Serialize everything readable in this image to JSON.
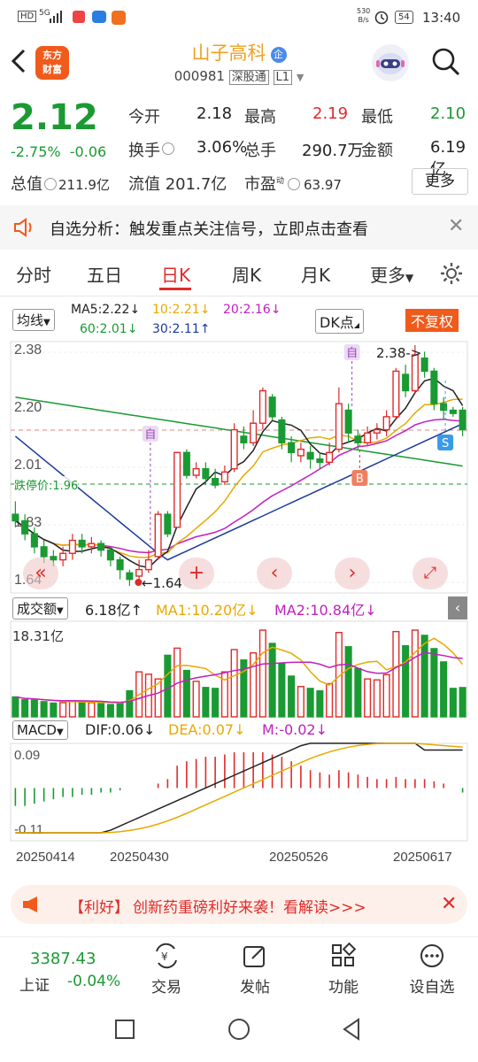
{
  "status": {
    "time": "13:40",
    "network": "5G",
    "hd": "HD",
    "speed": "530",
    "speed_unit": "B/s",
    "battery": "54"
  },
  "header": {
    "title": "山子高科",
    "badge": "企",
    "code": "000981",
    "exchange": "深股通",
    "level": "L1",
    "logo_line1": "东方",
    "logo_line2": "财富"
  },
  "quote": {
    "price": "2.12",
    "change_pct": "-2.75%",
    "change": "-0.06",
    "rows": [
      [
        {
          "label": "今开",
          "value": "2.18",
          "color": "#222"
        },
        {
          "label": "最高",
          "value": "2.19",
          "color": "#e02b2b"
        },
        {
          "label": "最低",
          "value": "2.10",
          "color": "#1a9a32"
        }
      ],
      [
        {
          "label": "换手",
          "value": "3.06%",
          "color": "#222"
        },
        {
          "label": "总手",
          "value": "290.7万",
          "color": "#222"
        },
        {
          "label": "金额",
          "value": "6.19亿",
          "color": "#222"
        }
      ]
    ],
    "total_mv_label": "总值",
    "total_mv": "211.9亿",
    "float_mv_label": "流值",
    "float_mv": "201.7亿",
    "pe_label": "市盈",
    "pe_sup": "动",
    "pe": "63.97",
    "more": "更多"
  },
  "alert": {
    "text": "自选分析：触发重点关注信号，立即点击查看"
  },
  "tabs": [
    "分时",
    "五日",
    "日K",
    "周K",
    "月K",
    "更多"
  ],
  "active_tab": 2,
  "chart_controls": {
    "ma_select": "均线",
    "ma5": "MA5:2.22↓",
    "ma10": "10:2.21↓",
    "ma20": "20:2.16↓",
    "ma60": "60:2.01↓",
    "ma30": "30:2.11↑",
    "dk": "DK点",
    "fq": "不复权",
    "limit_down": "跌停价:1.96",
    "high_label": "2.38->",
    "low_label": "←1.64",
    "tag_zi": "自",
    "tag_s": "S",
    "tag_b": "B"
  },
  "chart_data": [
    {
      "type": "candlestick",
      "title": "",
      "y_ticks": [
        "2.38",
        "2.20",
        "2.01",
        "1.83",
        "1.64"
      ],
      "ylim": [
        1.64,
        2.38
      ],
      "x_ticks": [
        "20250414",
        "20250430",
        "20250526",
        "20250617"
      ],
      "candles": [
        [
          1.86,
          1.84,
          1.9,
          1.82
        ],
        [
          1.84,
          1.8,
          1.86,
          1.78
        ],
        [
          1.8,
          1.76,
          1.82,
          1.74
        ],
        [
          1.76,
          1.73,
          1.78,
          1.71
        ],
        [
          1.73,
          1.72,
          1.75,
          1.7
        ],
        [
          1.72,
          1.74,
          1.76,
          1.7
        ],
        [
          1.74,
          1.78,
          1.8,
          1.72
        ],
        [
          1.78,
          1.76,
          1.8,
          1.74
        ],
        [
          1.76,
          1.77,
          1.79,
          1.74
        ],
        [
          1.77,
          1.75,
          1.78,
          1.73
        ],
        [
          1.75,
          1.72,
          1.76,
          1.7
        ],
        [
          1.72,
          1.69,
          1.73,
          1.66
        ],
        [
          1.68,
          1.66,
          1.69,
          1.64
        ],
        [
          1.67,
          1.69,
          1.72,
          1.65
        ],
        [
          1.69,
          1.72,
          1.75,
          1.68
        ],
        [
          1.73,
          1.86,
          1.87,
          1.72
        ],
        [
          1.86,
          1.8,
          1.87,
          1.79
        ],
        [
          1.82,
          2.05,
          2.05,
          1.82
        ],
        [
          2.05,
          1.98,
          2.06,
          1.97
        ],
        [
          1.98,
          2.0,
          2.02,
          1.97
        ],
        [
          2.0,
          1.97,
          2.02,
          1.95
        ],
        [
          1.97,
          1.95,
          2.0,
          1.94
        ],
        [
          1.96,
          1.99,
          2.01,
          1.95
        ],
        [
          2.0,
          2.12,
          2.14,
          1.99
        ],
        [
          2.1,
          2.08,
          2.13,
          2.06
        ],
        [
          2.08,
          2.14,
          2.18,
          2.07
        ],
        [
          2.14,
          2.24,
          2.25,
          2.12
        ],
        [
          2.22,
          2.16,
          2.23,
          2.15
        ],
        [
          2.15,
          2.08,
          2.16,
          2.06
        ],
        [
          2.08,
          2.05,
          2.1,
          2.02
        ],
        [
          2.04,
          2.06,
          2.08,
          2.02
        ],
        [
          2.05,
          2.03,
          2.07,
          2.0
        ],
        [
          2.03,
          2.02,
          2.05,
          2.0
        ],
        [
          2.02,
          2.05,
          2.08,
          2.01
        ],
        [
          2.06,
          2.2,
          2.25,
          2.05
        ],
        [
          2.18,
          2.11,
          2.2,
          2.08
        ],
        [
          2.1,
          2.08,
          2.12,
          2.06
        ],
        [
          2.08,
          2.11,
          2.13,
          2.07
        ],
        [
          2.11,
          2.12,
          2.14,
          2.09
        ],
        [
          2.12,
          2.16,
          2.18,
          2.1
        ],
        [
          2.16,
          2.3,
          2.31,
          2.15
        ],
        [
          2.29,
          2.24,
          2.32,
          2.22
        ],
        [
          2.24,
          2.35,
          2.38,
          2.23
        ],
        [
          2.34,
          2.3,
          2.36,
          2.28
        ],
        [
          2.3,
          2.2,
          2.31,
          2.18
        ],
        [
          2.2,
          2.18,
          2.22,
          2.15
        ],
        [
          2.18,
          2.17,
          2.19,
          2.16
        ],
        [
          2.18,
          2.12,
          2.19,
          2.1
        ]
      ]
    },
    {
      "type": "bar",
      "title": "成交额",
      "values_label": "6.18亿↑",
      "ma1": "MA1:10.20亿↓",
      "ma2": "MA2:10.84亿↓",
      "ymax_label": "18.31亿",
      "ylim": [
        0,
        18.31
      ]
    },
    {
      "type": "bar",
      "title": "MACD",
      "dif": "DIF:0.06↓",
      "dea": "DEA:0.07↓",
      "m": "M:-0.02↓",
      "y_ticks": [
        "0.09",
        "-0.11"
      ],
      "ylim": [
        -0.11,
        0.09
      ]
    }
  ],
  "promo": {
    "tag": "【利好】",
    "text": "创新药重磅利好来袭！看解读>>>"
  },
  "bottom_nav": {
    "index_value": "3387.43",
    "index_name": "上证",
    "index_change": "-0.04%",
    "items": [
      "交易",
      "发帖",
      "功能",
      "设自选"
    ]
  },
  "colors": {
    "up": "#e02b2b",
    "down": "#1a9a32",
    "accent": "#f05a1a",
    "title": "#f0a020"
  }
}
